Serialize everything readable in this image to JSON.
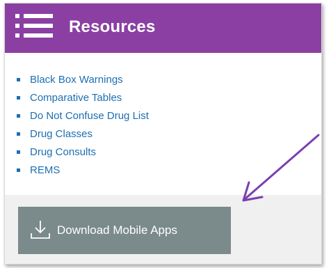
{
  "header": {
    "title": "Resources",
    "color": "#8b3fa3",
    "icon": "menu-icon"
  },
  "resources": {
    "links": [
      {
        "label": "Black Box Warnings"
      },
      {
        "label": "Comparative Tables"
      },
      {
        "label": "Do Not Confuse Drug List"
      },
      {
        "label": "Drug Classes"
      },
      {
        "label": "Drug Consults"
      },
      {
        "label": "REMS"
      }
    ],
    "link_color": "#1c6fb2"
  },
  "download": {
    "label": "Download Mobile Apps",
    "icon": "download-icon",
    "color": "#7b8a8b"
  },
  "annotation": {
    "icon": "arrow-icon",
    "color": "#7a3fb0"
  }
}
